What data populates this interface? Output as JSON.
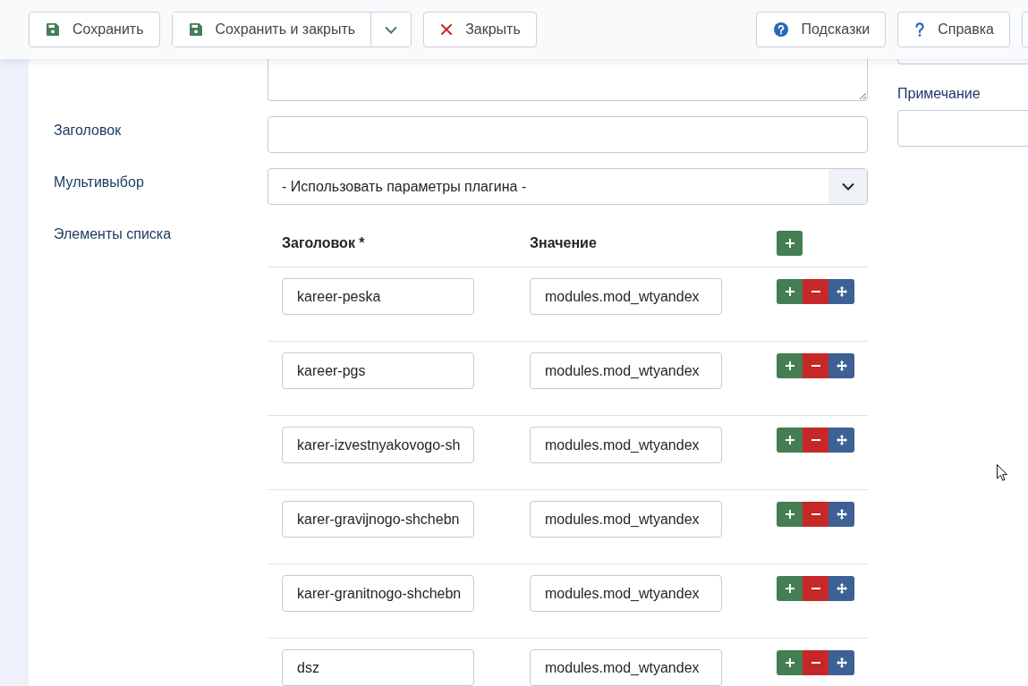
{
  "toolbar": {
    "left_buttons": [
      {
        "kind": "save",
        "label": "Сохранить",
        "dropdown": false
      },
      {
        "kind": "save",
        "label": "Сохранить и закрыть",
        "dropdown": true
      },
      {
        "kind": "close",
        "label": "Закрыть",
        "dropdown": false
      }
    ],
    "right_buttons": [
      {
        "kind": "hints",
        "label": "Подсказки",
        "dropdown": false
      },
      {
        "kind": "help",
        "label": "Справка",
        "dropdown": false
      }
    ],
    "cut_off_button": true
  },
  "form": {
    "fields": [
      {
        "kind": "textarea"
      },
      {
        "kind": "text",
        "label": "Заголовок"
      },
      {
        "kind": "select",
        "label": "Мультивыбор",
        "value": "- Использовать параметры плагина -"
      },
      {
        "kind": "subform",
        "label": "Элементы списка",
        "columns": [
          "Заголовок *",
          "Значение"
        ],
        "rows": [
          {
            "title": "kareer-peska",
            "value": "modules.mod_wtyandex"
          },
          {
            "title": "kareer-pgs",
            "value": "modules.mod_wtyandex"
          },
          {
            "title": "karer-izvestnyakovogo-sh",
            "value": "modules.mod_wtyandex"
          },
          {
            "title": "karer-gravijnogo-shchebn",
            "value": "modules.mod_wtyandex"
          },
          {
            "title": "karer-granitnogo-shchebn",
            "value": "modules.mod_wtyandex"
          },
          {
            "title": "dsz",
            "value": "modules.mod_wtyandex"
          }
        ]
      }
    ]
  },
  "side_panel": {
    "fields": [
      {
        "kind": "text"
      },
      {
        "kind": "text",
        "label": "Примечание"
      }
    ]
  }
}
